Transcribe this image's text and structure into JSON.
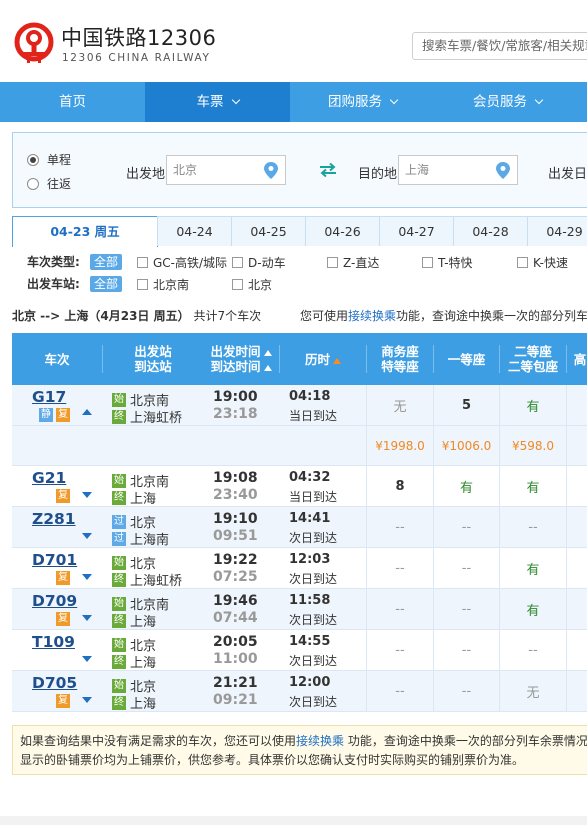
{
  "header": {
    "brand_cn": "中国铁路12306",
    "brand_en": "12306 CHINA RAILWAY",
    "search_placeholder": "搜索车票/餐饮/常旅客/相关规章",
    "brand_color": "#e2231a"
  },
  "nav": {
    "items": [
      {
        "label": "首页"
      },
      {
        "label": "车票"
      },
      {
        "label": "团购服务"
      },
      {
        "label": "会员服务"
      }
    ]
  },
  "query": {
    "trip_types": [
      "单程",
      "往返"
    ],
    "selected_trip": "单程",
    "from_label": "出发地",
    "from_value": "北京",
    "to_label": "目的地",
    "to_value": "上海",
    "date_label": "出发日"
  },
  "dates": [
    "04-23 周五",
    "04-24",
    "04-25",
    "04-26",
    "04-27",
    "04-28",
    "04-29"
  ],
  "filters": {
    "type_title": "车次类型:",
    "station_title": "出发车站:",
    "all_label": "全部",
    "types": [
      "GC-高铁/城际",
      "D-动车",
      "Z-直达",
      "T-特快",
      "K-快速"
    ],
    "stations": [
      "北京南",
      "北京"
    ]
  },
  "summary": {
    "route": "北京 --> 上海（4月23日  周五）",
    "count": "共计7个车次",
    "tip_prefix": "您可使用",
    "tip_link": "接续换乘",
    "tip_suffix": "功能，查询途中换乘一次的部分列车"
  },
  "table": {
    "headers": {
      "train": "车次",
      "station_1": "出发站",
      "station_2": "到达站",
      "time_1": "出发时间",
      "time_2": "到达时间",
      "duration": "历时",
      "business_1": "商务座",
      "business_2": "特等座",
      "first": "一等座",
      "second_1": "二等座",
      "second_2": "二等包座",
      "more": "高"
    },
    "rows": [
      {
        "no": "G17",
        "tags": [
          "静",
          "复"
        ],
        "from": "北京南",
        "to": "上海虹桥",
        "from_tag": "始",
        "to_tag": "终",
        "dep": "19:00",
        "arr": "23:18",
        "dur": "04:18",
        "note": "当日到达",
        "business": "无",
        "first": "5",
        "second": "有",
        "arrow": "up"
      },
      {
        "no": "G21",
        "tags": [
          "复"
        ],
        "from": "北京南",
        "to": "上海",
        "from_tag": "始",
        "to_tag": "终",
        "dep": "19:08",
        "arr": "23:40",
        "dur": "04:32",
        "note": "当日到达",
        "business": "8",
        "first": "有",
        "second": "有",
        "arrow": "down"
      },
      {
        "no": "Z281",
        "tags": [],
        "from": "北京",
        "to": "上海南",
        "from_tag": "过",
        "to_tag": "过",
        "dep": "19:10",
        "arr": "09:51",
        "dur": "14:41",
        "note": "次日到达",
        "business": "--",
        "first": "--",
        "second": "--",
        "arrow": "down"
      },
      {
        "no": "D701",
        "tags": [
          "复"
        ],
        "from": "北京",
        "to": "上海虹桥",
        "from_tag": "始",
        "to_tag": "终",
        "dep": "19:22",
        "arr": "07:25",
        "dur": "12:03",
        "note": "次日到达",
        "business": "--",
        "first": "--",
        "second": "有",
        "arrow": "down"
      },
      {
        "no": "D709",
        "tags": [
          "复"
        ],
        "from": "北京南",
        "to": "上海",
        "from_tag": "始",
        "to_tag": "终",
        "dep": "19:46",
        "arr": "07:44",
        "dur": "11:58",
        "note": "次日到达",
        "business": "--",
        "first": "--",
        "second": "有",
        "arrow": "down"
      },
      {
        "no": "T109",
        "tags": [],
        "from": "北京",
        "to": "上海",
        "from_tag": "始",
        "to_tag": "终",
        "dep": "20:05",
        "arr": "11:00",
        "dur": "14:55",
        "note": "次日到达",
        "business": "--",
        "first": "--",
        "second": "--",
        "arrow": "down"
      },
      {
        "no": "D705",
        "tags": [
          "复"
        ],
        "from": "北京",
        "to": "上海",
        "from_tag": "始",
        "to_tag": "终",
        "dep": "21:21",
        "arr": "09:21",
        "dur": "12:00",
        "note": "次日到达",
        "business": "--",
        "first": "--",
        "second": "无",
        "arrow": "down"
      }
    ],
    "prices": {
      "business": "¥1998.0",
      "first": "¥1006.0",
      "second": "¥598.0"
    }
  },
  "notice": {
    "line1_a": "如果查询结果中没有满足需求的车次，您还可以使用",
    "line1_link": "接续换乘",
    "line1_b": " 功能，查询途中换乘一次的部分列车余票情况",
    "line2": "显示的卧铺票价均为上铺票价，供您参考。具体票价以您确认支付时实际购买的铺别票价为准。"
  }
}
